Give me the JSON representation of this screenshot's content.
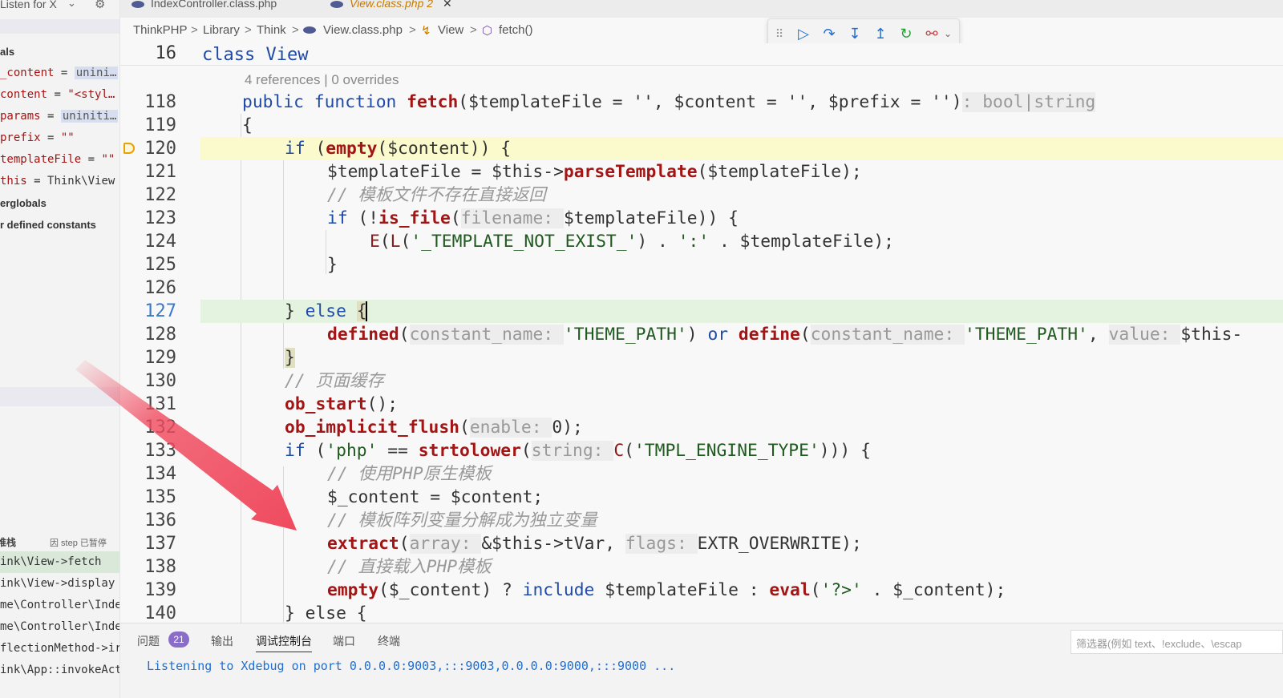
{
  "listen": {
    "label": "Listen for X",
    "chevron": "chevron-down-icon",
    "gear": "gear-icon"
  },
  "sidebar": {
    "section_locals": "als",
    "vars": [
      {
        "name": "_content",
        "eq": " = ",
        "value": "unini…",
        "chip": true
      },
      {
        "name": "content",
        "eq": " = ",
        "value": "\"<styl…",
        "chip": false
      },
      {
        "name": "params",
        "eq": " = ",
        "value": "uniniti…",
        "chip": true
      },
      {
        "name": "prefix",
        "eq": " = ",
        "value": "\"\"",
        "chip": false
      },
      {
        "name": "templateFile",
        "eq": " = ",
        "value": "\"\"",
        "chip": false
      },
      {
        "name": "this",
        "eq": " = ",
        "value": "Think\\View",
        "chip": false
      }
    ],
    "superglobals": "erglobals",
    "constants": "r defined constants",
    "callstack_title": "堆栈",
    "callstack_status": "因 step 已暂停",
    "stack": [
      "ink\\View->fetch",
      "ink\\View->display",
      "me\\Controller\\Inde",
      "me\\Controller\\Inde",
      "flectionMethod->ir",
      "ink\\App::invokeAct"
    ]
  },
  "tabs": [
    {
      "label": "IndexController.class.php",
      "active": false
    },
    {
      "label": "View.class.php 2",
      "active": true,
      "close": "✕"
    }
  ],
  "breadcrumb": [
    "ThinkPHP",
    "Library",
    "Think",
    "View.class.php",
    "View",
    "fetch()"
  ],
  "debug_toolbar": [
    "grip-icon",
    "continue-icon",
    "step-over-icon",
    "step-into-icon",
    "step-out-icon",
    "restart-icon",
    "disconnect-icon"
  ],
  "sticky": {
    "line": "16",
    "code_kw": "class ",
    "code_name": "View"
  },
  "editor": {
    "references": "4 references | 0 overrides",
    "lines": [
      {
        "n": "118"
      },
      {
        "n": "119"
      },
      {
        "n": "120"
      },
      {
        "n": "121"
      },
      {
        "n": "122"
      },
      {
        "n": "123"
      },
      {
        "n": "124"
      },
      {
        "n": "125"
      },
      {
        "n": "126"
      },
      {
        "n": "127"
      },
      {
        "n": "128"
      },
      {
        "n": "129"
      },
      {
        "n": "130"
      },
      {
        "n": "131"
      },
      {
        "n": "132"
      },
      {
        "n": "133"
      },
      {
        "n": "134"
      },
      {
        "n": "135"
      },
      {
        "n": "136"
      },
      {
        "n": "137"
      },
      {
        "n": "138"
      },
      {
        "n": "139"
      },
      {
        "n": "140"
      }
    ],
    "t": {
      "public": "public ",
      "function": "function ",
      "fetch": "fetch",
      "sig1": "($templateFile = '', $content = '', $prefix = '')",
      "ret": ": bool|string",
      "brace_open": "{",
      "if": "if ",
      "empty": "empty",
      "content_arg": "($content)",
      "brace_sp": ") {",
      "l121a": "$templateFile = $this->",
      "parseTemplate": "parseTemplate",
      "l121b": "($templateFile);",
      "c122": "// 模板文件不存在直接返回",
      "l123a": "(!",
      "is_file": "is_file",
      "l123hint": "filename: ",
      "l123b": "$templateFile)) {",
      "E": "E",
      "L": "L",
      "l124a": "(",
      "l124str": "'_TEMPLATE_NOT_EXIST_'",
      "l124b": ") . ",
      "l124colon": "':'",
      "l124c": " . $templateFile);",
      "close": "}",
      "else_a": "} ",
      "else": "else ",
      "else_b": "{",
      "defined": "defined",
      "cname_hint": "constant_name: ",
      "theme": "'THEME_PATH'",
      "or": " or ",
      "define": "define",
      "value_hint": "value: ",
      "this_trunc": "$this-",
      "c130": "// 页面缓存",
      "ob_start": "ob_start",
      "ob_start_tail": "();",
      "ob_flush": "ob_implicit_flush",
      "enable_hint": "enable: ",
      "zero": "0",
      "ob_flush_tail": ");",
      "l133_if": "if ",
      "l133a": "(",
      "php_str": "'php'",
      "l133b": " == ",
      "strtolower": "strtolower",
      "string_hint": "string: ",
      "C": "C",
      "tmpl": "'TMPL_ENGINE_TYPE'",
      "l133c": "))) {",
      "c134": "// 使用PHP原生模板",
      "l135": "$_content = $content;",
      "c136": "// 模板阵列变量分解成为独立变量",
      "extract": "extract",
      "array_hint": "array: ",
      "l137a": "&$this->tVar, ",
      "flags_hint": "flags: ",
      "l137b": "EXTR_OVERWRITE);",
      "c138": "// 直接载入PHP模板",
      "l139a": "($_content) ? ",
      "include": "include",
      "l139b": " $templateFile : ",
      "eval": "eval",
      "l139c": "(",
      "l139str": "'?>'",
      "l139d": " . $_content);",
      "l140": "} else {"
    }
  },
  "panel": {
    "tabs": [
      "问题",
      "输出",
      "调试控制台",
      "端口",
      "终端"
    ],
    "badge": "21",
    "filter_placeholder": "筛选器(例如 text、!exclude、\\escap",
    "console": "Listening to Xdebug on port 0.0.0.0:9003,:::9003,0.0.0.0:9000,:::9000 ..."
  },
  "colors": {
    "arrow": "#f04a5e",
    "current_line": "#fbfacd",
    "edit_line": "#e4f3e0",
    "keyword": "#1f4aa8",
    "function": "#a31515"
  }
}
